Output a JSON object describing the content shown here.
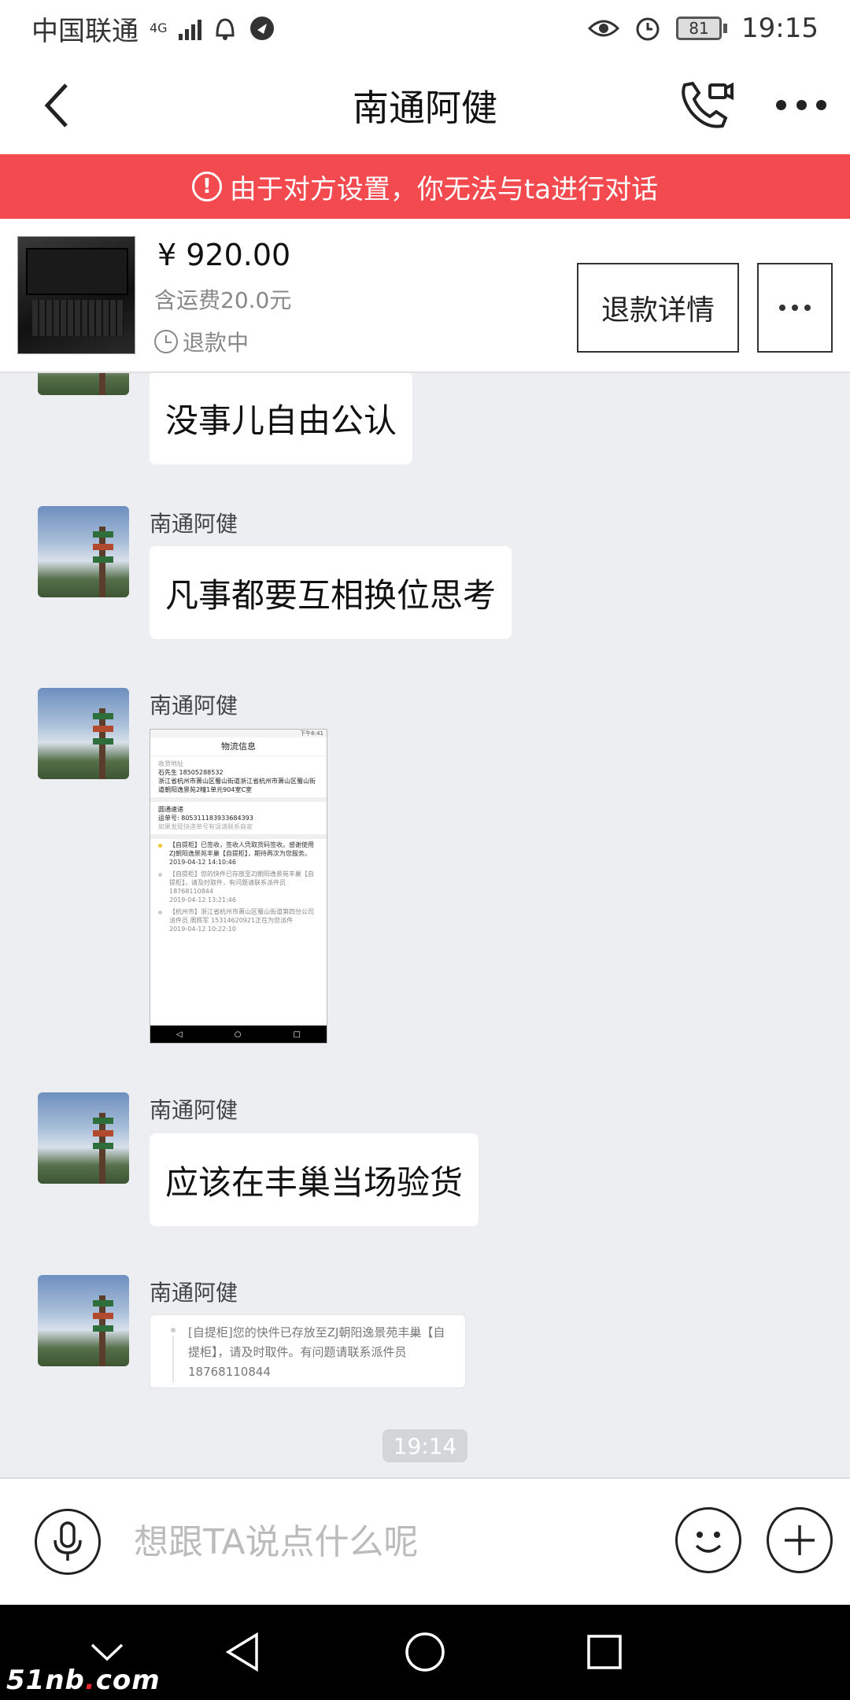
{
  "status_bar": {
    "carrier": "中国联通",
    "network": "4G",
    "time": "19:15",
    "battery": "81"
  },
  "nav": {
    "title": "南通阿健"
  },
  "banner": {
    "icon": "!",
    "text": "由于对方设置，你无法与ta进行对话"
  },
  "order": {
    "price": "¥ 920.00",
    "shipping": "含运费20.0元",
    "status": "退款中",
    "refund_button": "退款详情"
  },
  "messages": [
    {
      "sender": "",
      "text": "没事儿自由公认"
    },
    {
      "sender": "南通阿健",
      "text": "凡事都要互相换位思考"
    },
    {
      "sender": "南通阿健",
      "type": "image"
    },
    {
      "sender": "南通阿健",
      "text": "应该在丰巢当场验货"
    },
    {
      "sender": "南通阿健",
      "type": "card"
    }
  ],
  "image_msg": {
    "status_text": "下午6:41",
    "title": "物流信息",
    "addr_label": "收货地址",
    "receiver": "石先生  18505288532",
    "address": "浙江省杭州市萧山区蜀山街道浙江省杭州市萧山区蜀山街道朝阳逸景苑2幢1单元904室C室",
    "courier": "圆通速递",
    "tracking": "运单号: 805311183933684393",
    "hint": "如果发现快递单号有误请联系商家",
    "events": [
      {
        "text": "【自提柜】已签收，签收人凭取货码签收。感谢使用ZJ朝阳逸景苑丰巢【自提柜】，期待再次为您服务。",
        "time": "2019-04-12 14:10:46"
      },
      {
        "text": "【自提柜】您的快件已存放至ZJ朝阳逸景苑丰巢【自提柜】，请及时取件，有问题请联系派件员18768110844",
        "time": "2019-04-12 13:21:46"
      },
      {
        "text": "【杭州市】浙江省杭州市萧山区蜀山街道第四分公司派件员 周辉军 15314620921正在为您派件",
        "time": "2019-04-12 10:22:10"
      }
    ],
    "nav_back": "◁",
    "nav_home": "○",
    "nav_recent": "□"
  },
  "card_msg": {
    "text": "[自提柜]您的快件已存放至ZJ朝阳逸景苑丰巢【自提柜】，请及时取件。有问题请联系派件员18768110844"
  },
  "timestamp": "19:14",
  "input": {
    "placeholder": "想跟TA说点什么呢"
  },
  "watermark": {
    "prefix": "51nb",
    "dot": ".",
    "suffix": "com"
  }
}
